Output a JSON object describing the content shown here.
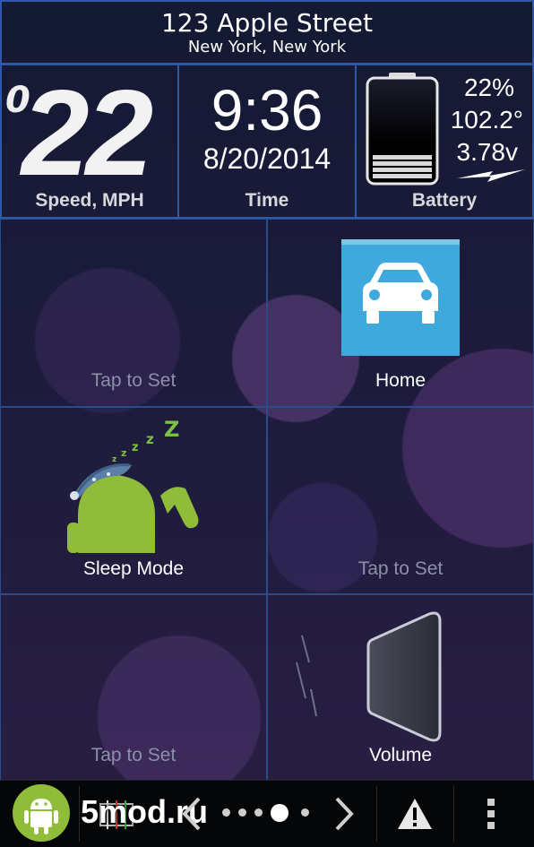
{
  "header": {
    "street": "123 Apple Street",
    "city": "New York, New York"
  },
  "speed": {
    "leading_digit": "0",
    "value": "22",
    "label": "Speed, MPH"
  },
  "time": {
    "time": "9:36",
    "date": "8/20/2014",
    "label": "Time"
  },
  "battery": {
    "percent": "22%",
    "temperature": "102.2°",
    "voltage": "3.78v",
    "label": "Battery"
  },
  "tiles": [
    {
      "label": "Tap to Set",
      "icon": "none"
    },
    {
      "label": "Home",
      "icon": "car-icon"
    },
    {
      "label": "Sleep Mode",
      "icon": "sleeping-android-icon"
    },
    {
      "label": "Tap to Set",
      "icon": "none"
    },
    {
      "label": "Tap to Set",
      "icon": "none"
    },
    {
      "label": "Volume",
      "icon": "speaker-icon"
    }
  ],
  "bottom_bar": {
    "watermark": "5mod.ru",
    "page_indicator": {
      "current": 4,
      "total": 5
    },
    "icons": [
      "android-icon",
      "chevron-left-icon",
      "chevron-right-icon",
      "warning-icon",
      "overflow-menu-icon"
    ]
  },
  "colors": {
    "accent_border": "#2e59a6",
    "car_tile": "#3fa9dd",
    "android_green": "#8fbd3a"
  }
}
